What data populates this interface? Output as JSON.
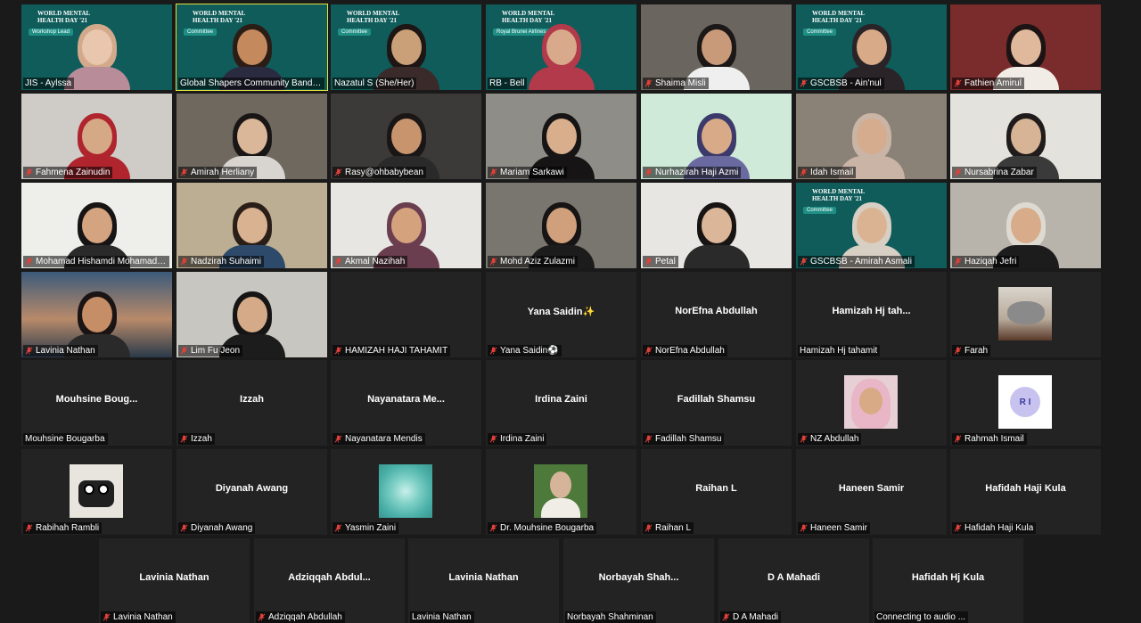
{
  "rows": [
    [
      {
        "name": "JIS - Aylssa",
        "muted": false,
        "kind": "banner",
        "banner": {
          "title": "WORLD MENTAL HEALTH DAY '21",
          "pill": "Workshop Lead"
        },
        "skin": "#e9c6ae",
        "hair": "#d2a98b",
        "shirt": "#b98c9a"
      },
      {
        "name": "Global Shapers Community Bandar ...",
        "muted": false,
        "active": true,
        "kind": "banner",
        "banner": {
          "title": "WORLD MENTAL HEALTH DAY '21",
          "pill": "Committee"
        },
        "skin": "#c48a5e",
        "hair": "#2b1d16",
        "shirt": "#2a2a40"
      },
      {
        "name": "Nazatul S (She/Her)",
        "muted": false,
        "kind": "banner",
        "banner": {
          "title": "WORLD MENTAL HEALTH DAY '21",
          "pill": "Committee"
        },
        "skin": "#caa078",
        "hair": "#1e1614",
        "shirt": "#3a2a2a"
      },
      {
        "name": "RB - Bell",
        "muted": false,
        "kind": "banner",
        "banner": {
          "title": "WORLD MENTAL HEALTH DAY '21",
          "pill": "Royal Brunei Airlines"
        },
        "skin": "#d8a98a",
        "hair": "#b23a4a",
        "shirt": "#b23a4a"
      },
      {
        "name": "Shaima Misli",
        "muted": true,
        "kind": "photo",
        "bg": "#6a655e",
        "skin": "#c99a7a",
        "hair": "#1c1818",
        "shirt": "#efefef"
      },
      {
        "name": "GSCBSB - Ain'nul",
        "muted": true,
        "kind": "banner",
        "banner": {
          "title": "WORLD MENTAL HEALTH DAY '21",
          "pill": "Committee"
        },
        "skin": "#d8aa88",
        "hair": "#2a2428",
        "shirt": "#2a2428"
      },
      {
        "name": "Fathien Amirul",
        "muted": true,
        "kind": "photo",
        "bg": "#7a2b2b",
        "skin": "#e0b89c",
        "hair": "#1c1414",
        "shirt": "#f2ece6"
      }
    ],
    [
      {
        "name": "Fahmena Zainudin",
        "muted": true,
        "kind": "photo",
        "bg": "#cfccc8",
        "skin": "#d6a986",
        "hair": "#b0242e",
        "shirt": "#b0242e"
      },
      {
        "name": "Amirah Herliany",
        "muted": true,
        "kind": "photo",
        "bg": "#6e685f",
        "skin": "#dbb79a",
        "hair": "#1a1616",
        "shirt": "#d8d4d0"
      },
      {
        "name": "Rasy@ohbabybean",
        "muted": true,
        "kind": "photo",
        "bg": "#3c3a38",
        "skin": "#c7946e",
        "hair": "#1a1616",
        "shirt": "#2a2a2a"
      },
      {
        "name": "Mariam Sarkawi",
        "muted": true,
        "kind": "photo",
        "bg": "#8f8d88",
        "skin": "#d8ae8c",
        "hair": "#161414",
        "shirt": "#161414"
      },
      {
        "name": "Nurhazirah Haji Azmi",
        "muted": true,
        "kind": "whmd",
        "bg": "#cfead8",
        "skin": "#d8aa88",
        "hair": "#3c3a6a",
        "shirt": "#6a6aa0"
      },
      {
        "name": "Idah Ismail",
        "muted": true,
        "kind": "photo",
        "bg": "#8a8276",
        "skin": "#d6ac8e",
        "hair": "#c9b4a6",
        "shirt": "#c9b4a6"
      },
      {
        "name": "Nursabrina Zabar",
        "muted": true,
        "kind": "photo",
        "bg": "#e4e2dc",
        "skin": "#d7b496",
        "hair": "#201c1c",
        "shirt": "#3a3a3a"
      }
    ],
    [
      {
        "name": "Mohamad Hishamdi Mohamad ...",
        "muted": true,
        "kind": "photo",
        "bg": "#eeeeea",
        "skin": "#d4a480",
        "hair": "#161414",
        "shirt": "#2a2a2a"
      },
      {
        "name": "Nadzirah Suhaimi",
        "muted": true,
        "kind": "photo",
        "bg": "#bcae92",
        "skin": "#d9b292",
        "hair": "#2a1e18",
        "shirt": "#2e4a6a"
      },
      {
        "name": "Akmal Nazihah",
        "muted": true,
        "kind": "photo",
        "bg": "#e8e6e2",
        "skin": "#d4a37e",
        "hair": "#6a3e4e",
        "shirt": "#6a3e4e"
      },
      {
        "name": "Mohd Aziz Zulazmi",
        "muted": true,
        "kind": "photo",
        "bg": "#78766e",
        "skin": "#d0a07c",
        "hair": "#161414",
        "shirt": "#1c1c1c"
      },
      {
        "name": "Petal",
        "muted": true,
        "kind": "photo",
        "bg": "#e8e6e2",
        "skin": "#dbb698",
        "hair": "#181414",
        "shirt": "#2a2a2a"
      },
      {
        "name": "GSCBSB - Amirah Asmali",
        "muted": true,
        "kind": "banner",
        "banner": {
          "title": "WORLD MENTAL HEALTH DAY '21",
          "pill": "Committee"
        },
        "skin": "#dab492",
        "hair": "#d8cfc4",
        "shirt": "#d8cfc4"
      },
      {
        "name": "Haziqah Jefri",
        "muted": true,
        "kind": "photo",
        "bg": "#b8b4ac",
        "skin": "#d8ac8a",
        "hair": "#dedad2",
        "shirt": "#1c1c1c"
      }
    ],
    [
      {
        "name": "Lavinia Nathan",
        "muted": true,
        "kind": "photo",
        "bg": "linear-gradient(180deg,#3c5a7a 0%,#b88a6a 55%,#2a3a4a 100%)",
        "skin": "#c68e66",
        "hair": "#1a1414",
        "shirt": "#2a2a2a"
      },
      {
        "name": "Lim Fu Jeon",
        "muted": true,
        "kind": "photo",
        "bg": "#c8c6c0",
        "skin": "#d4aa88",
        "hair": "#161414",
        "shirt": "#1c1c1c"
      },
      {
        "name": "HAMIZAH HAJI TAHAMIT",
        "muted": true,
        "kind": "blank"
      },
      {
        "name": "Yana Saidin⚽",
        "muted": true,
        "kind": "text",
        "big": "Yana  Saidin✨"
      },
      {
        "name": "NorEfna Abdullah",
        "muted": true,
        "kind": "text",
        "big": "NorEfna Abdullah"
      },
      {
        "name": "Hamizah Hj tahamit",
        "muted": false,
        "kind": "text",
        "big": "Hamizah  Hj  tah..."
      },
      {
        "name": "Farah",
        "muted": true,
        "kind": "thumb",
        "thumb": "cat"
      }
    ],
    [
      {
        "name": "Mouhsine Bougarba",
        "muted": false,
        "kind": "text",
        "big": "Mouhsine  Boug..."
      },
      {
        "name": "Izzah",
        "muted": true,
        "kind": "text",
        "big": "Izzah"
      },
      {
        "name": "Nayanatara Mendis",
        "muted": true,
        "kind": "text",
        "big": "Nayanatara  Me..."
      },
      {
        "name": "Irdina Zaini",
        "muted": true,
        "kind": "text",
        "big": "Irdina Zaini"
      },
      {
        "name": "Fadillah Shamsu",
        "muted": true,
        "kind": "text",
        "big": "Fadillah Shamsu"
      },
      {
        "name": "NZ Abdullah",
        "muted": true,
        "kind": "thumb",
        "thumb": "hijab"
      },
      {
        "name": "Rahmah Ismail",
        "muted": true,
        "kind": "rmbadge",
        "initials": "R I"
      }
    ],
    [
      {
        "name": "Rabihah Rambli",
        "muted": true,
        "kind": "thumb",
        "thumb": "toy"
      },
      {
        "name": "Diyanah Awang",
        "muted": true,
        "kind": "text",
        "big": "Diyanah Awang"
      },
      {
        "name": "Yasmin Zaini",
        "muted": true,
        "kind": "thumb",
        "thumb": "flower"
      },
      {
        "name": "Dr. Mouhsine Bougarba",
        "muted": true,
        "kind": "thumb",
        "thumb": "man"
      },
      {
        "name": "Raihan L",
        "muted": true,
        "kind": "text",
        "big": "Raihan L"
      },
      {
        "name": "Haneen Samir",
        "muted": true,
        "kind": "text",
        "big": "Haneen Samir"
      },
      {
        "name": "Hafidah Haji Kula",
        "muted": true,
        "kind": "text",
        "big": "Hafidah Haji Kula"
      }
    ],
    [
      {
        "name": "Lavinia Nathan",
        "muted": true,
        "kind": "text",
        "big": "Lavinia Nathan"
      },
      {
        "name": "Adziqqah Abdullah",
        "muted": true,
        "kind": "text",
        "big": "Adziqqah  Abdul..."
      },
      {
        "name": "Lavinia Nathan",
        "muted": false,
        "kind": "text",
        "big": "Lavinia Nathan"
      },
      {
        "name": "Norbayah Shahminan",
        "muted": false,
        "kind": "text",
        "big": "Norbayah  Shah..."
      },
      {
        "name": "D A Mahadi",
        "muted": true,
        "kind": "text",
        "big": "D A Mahadi"
      },
      {
        "name": "Connecting to audio ...",
        "muted": false,
        "kind": "text",
        "big": "Hafidah Hj Kula"
      }
    ]
  ],
  "colors": {
    "background": "#1a1a1a",
    "tile": "#232323",
    "active_outline": "#e2e23a",
    "banner_teal": "#0f5c5a",
    "mic_muted": "#e0403a"
  },
  "icons": {
    "muted": "muted-mic-icon"
  }
}
